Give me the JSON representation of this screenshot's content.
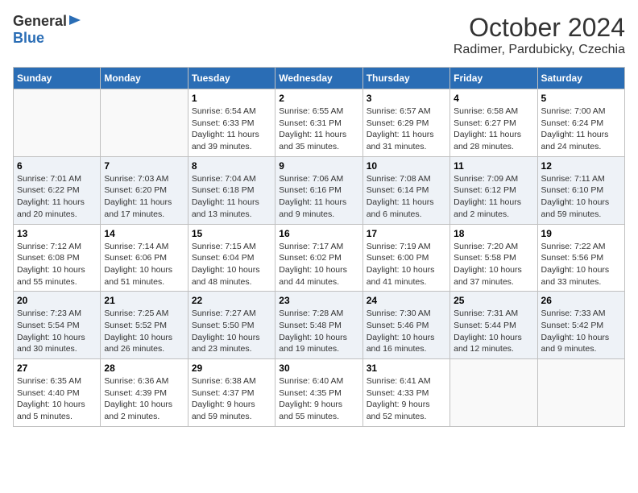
{
  "header": {
    "logo_general": "General",
    "logo_blue": "Blue",
    "title": "October 2024",
    "subtitle": "Radimer, Pardubicky, Czechia"
  },
  "calendar": {
    "days_of_week": [
      "Sunday",
      "Monday",
      "Tuesday",
      "Wednesday",
      "Thursday",
      "Friday",
      "Saturday"
    ],
    "weeks": [
      [
        {
          "day": "",
          "info": ""
        },
        {
          "day": "",
          "info": ""
        },
        {
          "day": "1",
          "info": "Sunrise: 6:54 AM\nSunset: 6:33 PM\nDaylight: 11 hours\nand 39 minutes."
        },
        {
          "day": "2",
          "info": "Sunrise: 6:55 AM\nSunset: 6:31 PM\nDaylight: 11 hours\nand 35 minutes."
        },
        {
          "day": "3",
          "info": "Sunrise: 6:57 AM\nSunset: 6:29 PM\nDaylight: 11 hours\nand 31 minutes."
        },
        {
          "day": "4",
          "info": "Sunrise: 6:58 AM\nSunset: 6:27 PM\nDaylight: 11 hours\nand 28 minutes."
        },
        {
          "day": "5",
          "info": "Sunrise: 7:00 AM\nSunset: 6:24 PM\nDaylight: 11 hours\nand 24 minutes."
        }
      ],
      [
        {
          "day": "6",
          "info": "Sunrise: 7:01 AM\nSunset: 6:22 PM\nDaylight: 11 hours\nand 20 minutes."
        },
        {
          "day": "7",
          "info": "Sunrise: 7:03 AM\nSunset: 6:20 PM\nDaylight: 11 hours\nand 17 minutes."
        },
        {
          "day": "8",
          "info": "Sunrise: 7:04 AM\nSunset: 6:18 PM\nDaylight: 11 hours\nand 13 minutes."
        },
        {
          "day": "9",
          "info": "Sunrise: 7:06 AM\nSunset: 6:16 PM\nDaylight: 11 hours\nand 9 minutes."
        },
        {
          "day": "10",
          "info": "Sunrise: 7:08 AM\nSunset: 6:14 PM\nDaylight: 11 hours\nand 6 minutes."
        },
        {
          "day": "11",
          "info": "Sunrise: 7:09 AM\nSunset: 6:12 PM\nDaylight: 11 hours\nand 2 minutes."
        },
        {
          "day": "12",
          "info": "Sunrise: 7:11 AM\nSunset: 6:10 PM\nDaylight: 10 hours\nand 59 minutes."
        }
      ],
      [
        {
          "day": "13",
          "info": "Sunrise: 7:12 AM\nSunset: 6:08 PM\nDaylight: 10 hours\nand 55 minutes."
        },
        {
          "day": "14",
          "info": "Sunrise: 7:14 AM\nSunset: 6:06 PM\nDaylight: 10 hours\nand 51 minutes."
        },
        {
          "day": "15",
          "info": "Sunrise: 7:15 AM\nSunset: 6:04 PM\nDaylight: 10 hours\nand 48 minutes."
        },
        {
          "day": "16",
          "info": "Sunrise: 7:17 AM\nSunset: 6:02 PM\nDaylight: 10 hours\nand 44 minutes."
        },
        {
          "day": "17",
          "info": "Sunrise: 7:19 AM\nSunset: 6:00 PM\nDaylight: 10 hours\nand 41 minutes."
        },
        {
          "day": "18",
          "info": "Sunrise: 7:20 AM\nSunset: 5:58 PM\nDaylight: 10 hours\nand 37 minutes."
        },
        {
          "day": "19",
          "info": "Sunrise: 7:22 AM\nSunset: 5:56 PM\nDaylight: 10 hours\nand 33 minutes."
        }
      ],
      [
        {
          "day": "20",
          "info": "Sunrise: 7:23 AM\nSunset: 5:54 PM\nDaylight: 10 hours\nand 30 minutes."
        },
        {
          "day": "21",
          "info": "Sunrise: 7:25 AM\nSunset: 5:52 PM\nDaylight: 10 hours\nand 26 minutes."
        },
        {
          "day": "22",
          "info": "Sunrise: 7:27 AM\nSunset: 5:50 PM\nDaylight: 10 hours\nand 23 minutes."
        },
        {
          "day": "23",
          "info": "Sunrise: 7:28 AM\nSunset: 5:48 PM\nDaylight: 10 hours\nand 19 minutes."
        },
        {
          "day": "24",
          "info": "Sunrise: 7:30 AM\nSunset: 5:46 PM\nDaylight: 10 hours\nand 16 minutes."
        },
        {
          "day": "25",
          "info": "Sunrise: 7:31 AM\nSunset: 5:44 PM\nDaylight: 10 hours\nand 12 minutes."
        },
        {
          "day": "26",
          "info": "Sunrise: 7:33 AM\nSunset: 5:42 PM\nDaylight: 10 hours\nand 9 minutes."
        }
      ],
      [
        {
          "day": "27",
          "info": "Sunrise: 6:35 AM\nSunset: 4:40 PM\nDaylight: 10 hours\nand 5 minutes."
        },
        {
          "day": "28",
          "info": "Sunrise: 6:36 AM\nSunset: 4:39 PM\nDaylight: 10 hours\nand 2 minutes."
        },
        {
          "day": "29",
          "info": "Sunrise: 6:38 AM\nSunset: 4:37 PM\nDaylight: 9 hours\nand 59 minutes."
        },
        {
          "day": "30",
          "info": "Sunrise: 6:40 AM\nSunset: 4:35 PM\nDaylight: 9 hours\nand 55 minutes."
        },
        {
          "day": "31",
          "info": "Sunrise: 6:41 AM\nSunset: 4:33 PM\nDaylight: 9 hours\nand 52 minutes."
        },
        {
          "day": "",
          "info": ""
        },
        {
          "day": "",
          "info": ""
        }
      ]
    ]
  }
}
